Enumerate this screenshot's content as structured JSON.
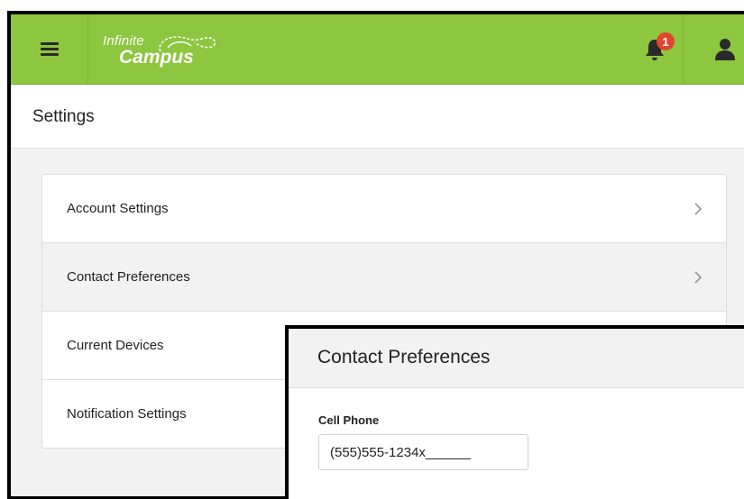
{
  "header": {
    "logo_line1": "Infinite",
    "logo_line2": "Campus",
    "notification_count": "1",
    "menu_icon": "hamburger-icon",
    "bell_icon": "bell-icon",
    "user_icon": "user-icon",
    "colors": {
      "bar": "#8dc63f",
      "badge": "#e0462c"
    }
  },
  "page": {
    "title": "Settings"
  },
  "settings_list": [
    {
      "label": "Account Settings",
      "active": false
    },
    {
      "label": "Contact Preferences",
      "active": true
    },
    {
      "label": "Current Devices",
      "active": false
    },
    {
      "label": "Notification Settings",
      "active": false
    }
  ],
  "detail_panel": {
    "title": "Contact Preferences",
    "cell_phone_label": "Cell Phone",
    "cell_phone_value": "(555)555-1234x______"
  }
}
